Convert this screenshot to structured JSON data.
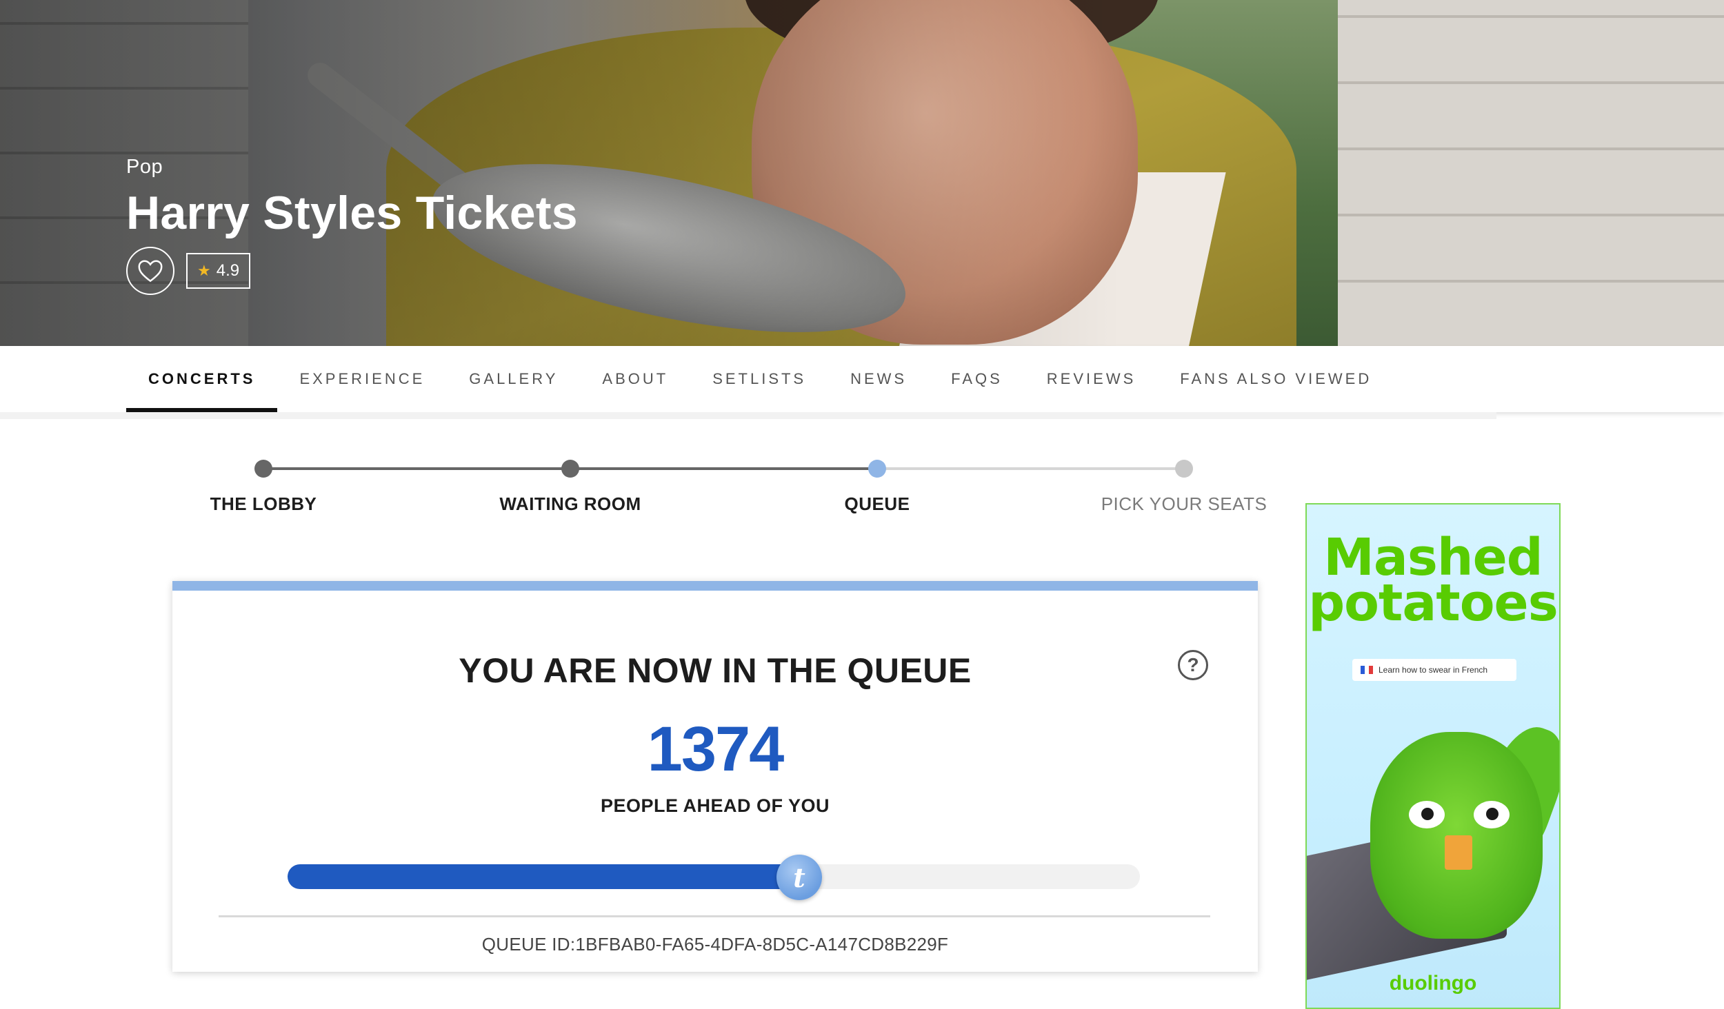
{
  "hero": {
    "genre": "Pop",
    "title": "Harry Styles Tickets",
    "rating": "4.9",
    "favorite_icon": "heart-outline-icon",
    "star_icon": "star-icon"
  },
  "nav": {
    "tabs": [
      {
        "label": "CONCERTS",
        "active": true
      },
      {
        "label": "EXPERIENCE",
        "active": false
      },
      {
        "label": "GALLERY",
        "active": false
      },
      {
        "label": "ABOUT",
        "active": false
      },
      {
        "label": "SETLISTS",
        "active": false
      },
      {
        "label": "NEWS",
        "active": false
      },
      {
        "label": "FAQS",
        "active": false
      },
      {
        "label": "REVIEWS",
        "active": false
      },
      {
        "label": "FANS ALSO VIEWED",
        "active": false
      }
    ]
  },
  "stepper": {
    "steps": [
      {
        "label": "THE LOBBY",
        "state": "done"
      },
      {
        "label": "WAITING ROOM",
        "state": "done"
      },
      {
        "label": "QUEUE",
        "state": "current"
      },
      {
        "label": "PICK YOUR SEATS",
        "state": "upcoming"
      }
    ],
    "colors": {
      "done": "#666666",
      "current": "#8fb5e6",
      "upcoming": "#c8c8c8"
    }
  },
  "queue": {
    "heading": "YOU ARE NOW IN THE QUEUE",
    "people_ahead": "1374",
    "people_ahead_label": "PEOPLE AHEAD OF YOU",
    "progress": 0.6,
    "knob_glyph": "t",
    "help_glyph": "?",
    "queue_id": "QUEUE ID:1BFBAB0-FA65-4DFA-8D5C-A147CD8B229F",
    "accent": "#1f5ac0"
  },
  "ad": {
    "headline_line1": "Mashed",
    "headline_line2": "potatoes",
    "pill_text": "Learn how to swear in French",
    "brand": "duolingo",
    "brand_color": "#58cc02"
  }
}
